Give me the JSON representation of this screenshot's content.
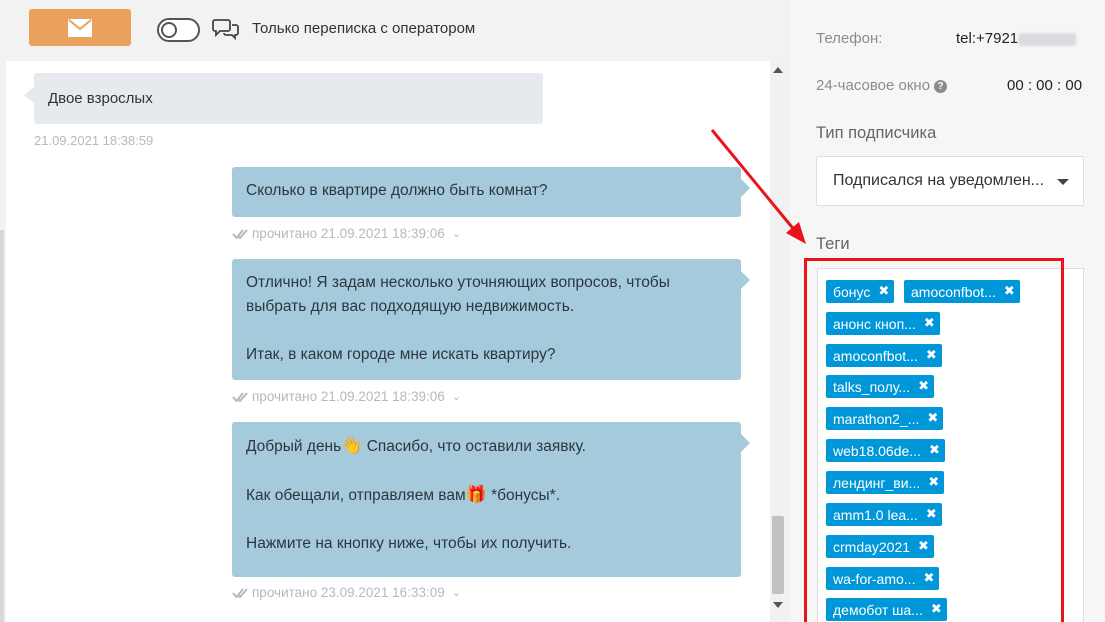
{
  "topbar": {
    "mail_icon": "envelope-icon",
    "toggle_label": "Только переписка с оператором",
    "toggle_on": false,
    "chat_icon": "chat-bubbles-icon"
  },
  "messages": [
    {
      "direction": "incoming",
      "text": "Двое взрослых",
      "timestamp": "21.09.2021 18:38:59"
    },
    {
      "direction": "outgoing",
      "paragraphs": [
        "Сколько в квартире должно быть комнат?"
      ],
      "status": "прочитано 21.09.2021 18:39:06"
    },
    {
      "direction": "outgoing",
      "paragraphs": [
        "Отлично! Я задам несколько уточняющих вопросов, чтобы выбрать для вас подходящую недвижимость.",
        "Итак, в каком городе мне искать квартиру?"
      ],
      "status": "прочитано 21.09.2021 18:39:06"
    },
    {
      "direction": "outgoing",
      "paragraphs": [
        "Добрый день",
        "Спасибо, что оставили заявку.",
        "Как обещали, отправляем вам",
        "*бонусы*.",
        "Нажмите на кнопку ниже, чтобы их получить."
      ],
      "status": "прочитано 23.09.2021 16:33:09",
      "emoji": [
        "👋",
        "🎁"
      ]
    }
  ],
  "sidebar": {
    "phone_label": "Телефон:",
    "phone_value": "tel:+7921",
    "window_label": "24-часовое окно",
    "window_value": "00 : 00 : 00",
    "subscriber_type_label": "Тип подписчика",
    "subscriber_type_value": "Подписался на уведомлен...",
    "tags_label": "Теги",
    "tags": [
      "бонус",
      "amoconfbot...",
      "анонс кноп...",
      "amoconfbot...",
      "talks_полу...",
      "marathon2_...",
      "web18.06de...",
      "лендинг_ви...",
      "amm1.0 lea...",
      "crmday2021",
      "wa-for-amo...",
      "демобот ша..."
    ]
  },
  "colors": {
    "mail_button": "#e9a15c",
    "bubble_out": "#a5cadc",
    "bubble_in": "#e6e9ed",
    "tag": "#0097d9",
    "annotation": "#e8141a"
  }
}
